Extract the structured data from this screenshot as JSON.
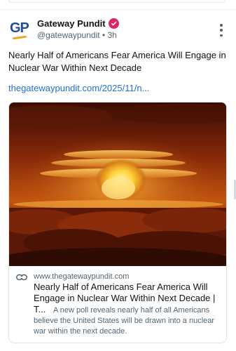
{
  "post": {
    "author_name": "Gateway Pundit",
    "author_initials": "GP",
    "handle": "@gatewaypundit",
    "separator": "•",
    "time": "3h",
    "text": "Nearly Half of Americans Fear America Will Engage in Nuclear War Within Next Decade",
    "link_text": "thegatewaypundit.com/2025/11/n..."
  },
  "card": {
    "domain": "www.thegatewaypundit.com",
    "title": "Nearly Half of Americans Fear America Will Engage in Nuclear War Within Next Decade | T...",
    "description": "A new poll reveals nearly half of all Americans believe the United States will be drawn into a nuclear war within the next decade."
  },
  "icons": {
    "verified": "verified-badge-icon",
    "more": "more-options-icon",
    "link": "link-icon"
  },
  "colors": {
    "verified_badge": "#e0245e",
    "link": "#1d70d6",
    "avatar_blue": "#1f4e96",
    "avatar_orange": "#f2a31b"
  }
}
